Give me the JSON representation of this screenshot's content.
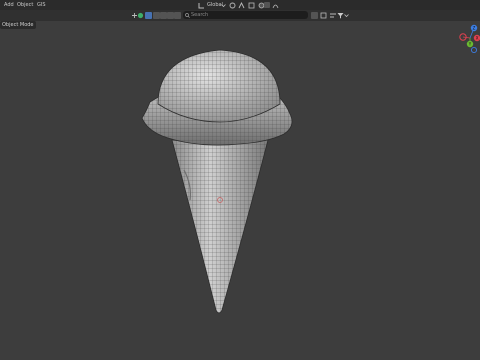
{
  "header": {
    "menu": [
      "Add",
      "Object",
      "GIS"
    ],
    "orientation": "Global",
    "mode_dropdown": "Object Mode",
    "search_placeholder": "Search"
  },
  "gizmo": {
    "axes": [
      "X",
      "Y",
      "Z"
    ],
    "colors": {
      "x": "#e0414f",
      "y": "#6bba31",
      "z": "#3c7ee4"
    }
  },
  "viewport": {
    "object": "ice cream cone",
    "background": "#3d3d3d"
  }
}
